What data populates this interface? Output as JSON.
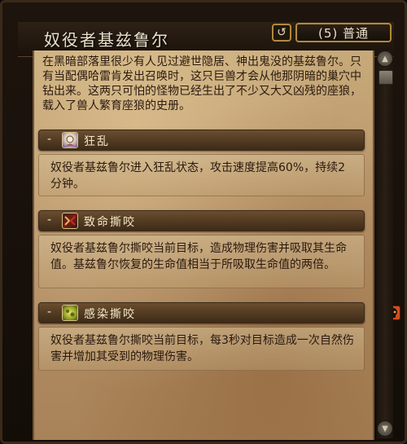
{
  "header": {
    "title": "奴役者基兹鲁尔",
    "back_icon": "↺",
    "difficulty": "(5) 普通"
  },
  "description": "在黑暗部落里很少有人见过避世隐居、神出鬼没的基兹鲁尔。只有当配偶哈雷肯发出召唤时，这只巨兽才会从他那阴暗的巢穴中钻出来。这两只可怕的怪物已经生出了不少又大又凶残的座狼，载入了兽人繁育座狼的史册。",
  "abilities": [
    {
      "toggle": "-",
      "label": "狂乱",
      "icon": "frenzy-icon",
      "text": "奴役者基兹鲁尔进入狂乱状态，攻击速度提高60%，持续2分钟。"
    },
    {
      "toggle": "-",
      "label": "致命撕咬",
      "icon": "mortal-bite-icon",
      "text": "奴役者基兹鲁尔撕咬当前目标，造成物理伤害并吸取其生命值。基兹鲁尔恢复的生命值相当于所吸取生命值的两倍。"
    },
    {
      "toggle": "-",
      "label": "感染撕咬",
      "icon": "infected-bite-icon",
      "text": "奴役者基兹鲁尔撕咬当前目标，每3秒对目标造成一次自然伤害并增加其受到的物理伤害。",
      "badge_icon": "skull-icon"
    }
  ],
  "colors": {
    "parchment": "#b9956a",
    "header_bg": "#3d2a17",
    "text": "#2a1a0f",
    "gold_border": "#b28a3a"
  }
}
